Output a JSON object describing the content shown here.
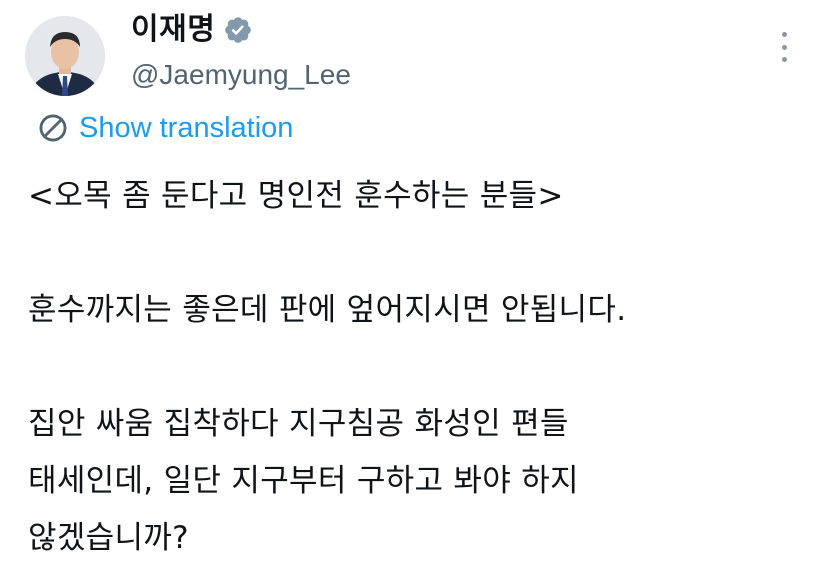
{
  "author": {
    "name": "이재명",
    "handle": "@Jaemyung_Lee",
    "verified_icon": "verified-badge-icon",
    "avatar_icon": "profile-photo"
  },
  "more_icon": "more-options-icon",
  "translation": {
    "icon": "globe-translate-icon",
    "label": "Show translation"
  },
  "tweet": {
    "lines": [
      "<오목 좀 둔다고 명인전 훈수하는 분들>",
      "",
      "훈수까지는 좋은데 판에 엎어지시면 안됩니다.",
      "",
      "집안 싸움 집착하다 지구침공 화성인 편들",
      "태세인데, 일단 지구부터 구하고 봐야 하지",
      "않겠습니까?"
    ]
  },
  "colors": {
    "text": "#0f1419",
    "secondary": "#536471",
    "link": "#1d9bf0",
    "verified": "#829aab"
  }
}
